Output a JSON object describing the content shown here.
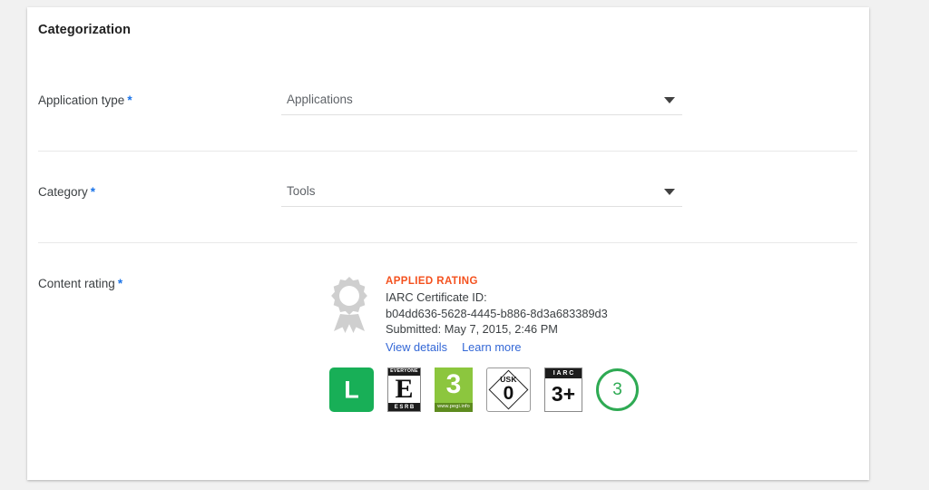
{
  "card": {
    "title": "Categorization"
  },
  "fields": {
    "application_type": {
      "label": "Application type",
      "required_mark": "*",
      "value": "Applications",
      "arrow_icon": "chevron-down-icon"
    },
    "category": {
      "label": "Category",
      "required_mark": "*",
      "value": "Tools",
      "arrow_icon": "chevron-down-icon"
    },
    "content_rating": {
      "label": "Content rating",
      "required_mark": "*",
      "status": "APPLIED RATING",
      "certificate_label": "IARC Certificate ID:",
      "certificate_id": "b04dd636-5628-4445-b886-8d3a683389d3",
      "submitted": "Submitted: May 7, 2015, 2:46 PM",
      "view_details_link": "View details",
      "learn_more_link": "Learn more",
      "award_icon": "award-ribbon-icon"
    }
  },
  "rating_badges": [
    {
      "name": "classind-badge",
      "system": "ClassInd",
      "rating": "L"
    },
    {
      "name": "esrb-badge",
      "system": "ESRB",
      "top_text": "EVERYONE",
      "rating": "E",
      "bottom_text": "ESRB"
    },
    {
      "name": "pegi-badge",
      "system": "PEGI",
      "rating": "3",
      "url_text": "www.pegi.info"
    },
    {
      "name": "usk-badge",
      "system": "USK",
      "label": "USK",
      "rating": "0"
    },
    {
      "name": "iarc-badge",
      "system": "IARC",
      "label": "IARC",
      "rating": "3+"
    },
    {
      "name": "generic-age-badge",
      "system": "Generic",
      "rating": "3"
    }
  ],
  "colors": {
    "page_background": "#f1f1f1",
    "card_background": "#ffffff",
    "required_asterisk": "#1a73e8",
    "applied_rating": "#f4511e",
    "link": "#3367d6",
    "classind_green": "#18af57",
    "pegi_green": "#8cc63e",
    "circle_green": "#2eaa53",
    "divider": "#e8e8e8"
  }
}
